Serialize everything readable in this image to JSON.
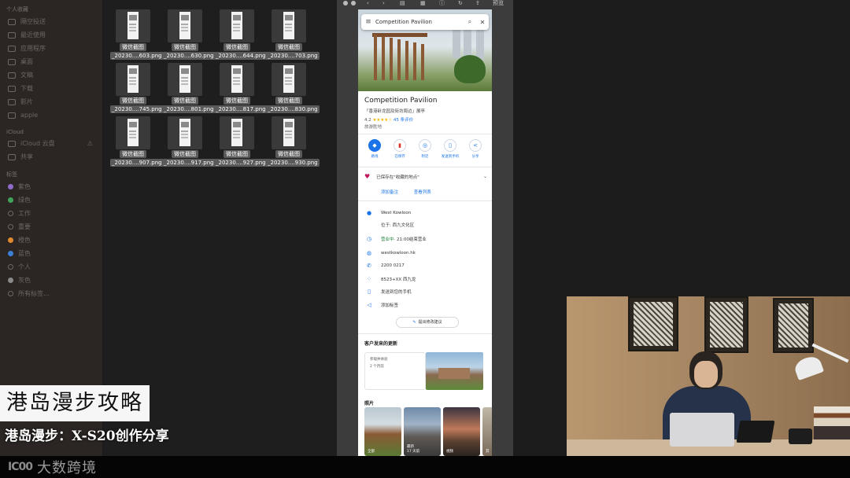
{
  "sidebar": {
    "sections": {
      "personal": "个人收藏",
      "icloud": "iCloud",
      "tags": "标签"
    },
    "favorites": [
      "隔空投送",
      "最近使用",
      "应用程序",
      "桌面",
      "文稿",
      "下载",
      "影片",
      "apple"
    ],
    "icloud": [
      "iCloud 云盘",
      "共享"
    ],
    "tags": [
      {
        "label": "紫色",
        "color": "#8e6bc7"
      },
      {
        "label": "绿色",
        "color": "#3fa35a"
      },
      {
        "label": "工作",
        "color": ""
      },
      {
        "label": "重要",
        "color": ""
      },
      {
        "label": "橙色",
        "color": "#e08a2e"
      },
      {
        "label": "蓝色",
        "color": "#3c7fd6"
      },
      {
        "label": "个人",
        "color": ""
      },
      {
        "label": "灰色",
        "color": "#8a8a8a"
      },
      {
        "label": "所有标签…",
        "color": ""
      }
    ]
  },
  "files": {
    "title": "微信截图",
    "items": [
      "_20230....603.png",
      "_20230....630.png",
      "_20230....644.png",
      "_20230....703.png",
      "_20230....745.png",
      "_20230....801.png",
      "_20230....817.png",
      "_20230....830.png",
      "_20230....907.png",
      "_20230....917.png",
      "_20230....927.png",
      "_20230....930.png"
    ]
  },
  "preview": {
    "toolbar_label": "预览"
  },
  "maps": {
    "search_query": "Competition Pavilion",
    "place_title": "Competition Pavilion",
    "subtitle": "「香港卧龙园及街坊周边」展亭",
    "rating": "4.2",
    "stars": "★★★★☆",
    "reviews": "45 条评价",
    "category": "旅游胜地",
    "actions": [
      {
        "label": "路线",
        "icon": "◆",
        "primary": true
      },
      {
        "label": "已保存",
        "icon": "▮",
        "red": true
      },
      {
        "label": "附近",
        "icon": "◎"
      },
      {
        "label": "发送到手机",
        "icon": "▯"
      },
      {
        "label": "分享",
        "icon": "<"
      }
    ],
    "saved_text": "已保存在\"收藏的地点\"",
    "links": [
      "添加备注",
      "查看列表"
    ],
    "info": [
      {
        "icon": "●",
        "text": "West Kowloon"
      },
      {
        "icon": "",
        "text": "位于: 西九文化区"
      },
      {
        "icon": "◷",
        "text_open": "营业中",
        "text": " · 21:00结束营业"
      },
      {
        "icon": "◍",
        "text": "westkowloon.hk"
      },
      {
        "icon": "✆",
        "text": "2200 0217"
      },
      {
        "icon": "⁘",
        "text": "8523+XX 西九龙"
      },
      {
        "icon": "▯",
        "text": "发送到您的手机"
      },
      {
        "icon": "◁",
        "text": "添加标签"
      }
    ],
    "suggest_edit": "提出修改建议",
    "updates_title": "客户发来的更新",
    "update_card_line1": "参观并体验",
    "update_card_line2": "2 个月前",
    "photos_title": "照片",
    "photos": [
      {
        "label": "全部",
        "sub": ""
      },
      {
        "label": "最新",
        "sub": "17 天前"
      },
      {
        "label": "视频",
        "sub": ""
      },
      {
        "label": "其",
        "sub": ""
      }
    ]
  },
  "overlay": {
    "title": "港岛漫步攻略",
    "subtitle": "港岛漫步：X-S20创作分享",
    "brand_logo": "大数跨境",
    "brand_mark": "IC00"
  }
}
